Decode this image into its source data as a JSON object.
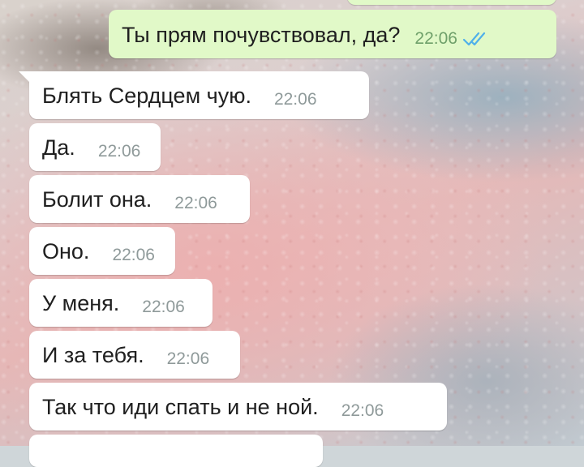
{
  "chat": {
    "outgoing": {
      "text": "Ты прям почувствовал, да?",
      "time": "22:06",
      "status_icon": "double-check-icon",
      "status_color": "#4fb0ea"
    },
    "incoming": [
      {
        "text": "Блять Сердцем чую.",
        "time": "22:06"
      },
      {
        "text": "Да.",
        "time": "22:06"
      },
      {
        "text": "Болит она.",
        "time": "22:06"
      },
      {
        "text": "Оно.",
        "time": "22:06"
      },
      {
        "text": "У меня.",
        "time": "22:06"
      },
      {
        "text": "И за тебя.",
        "time": "22:06"
      },
      {
        "text": "Так что иди спать и не ной.",
        "time": "22:06"
      }
    ]
  }
}
